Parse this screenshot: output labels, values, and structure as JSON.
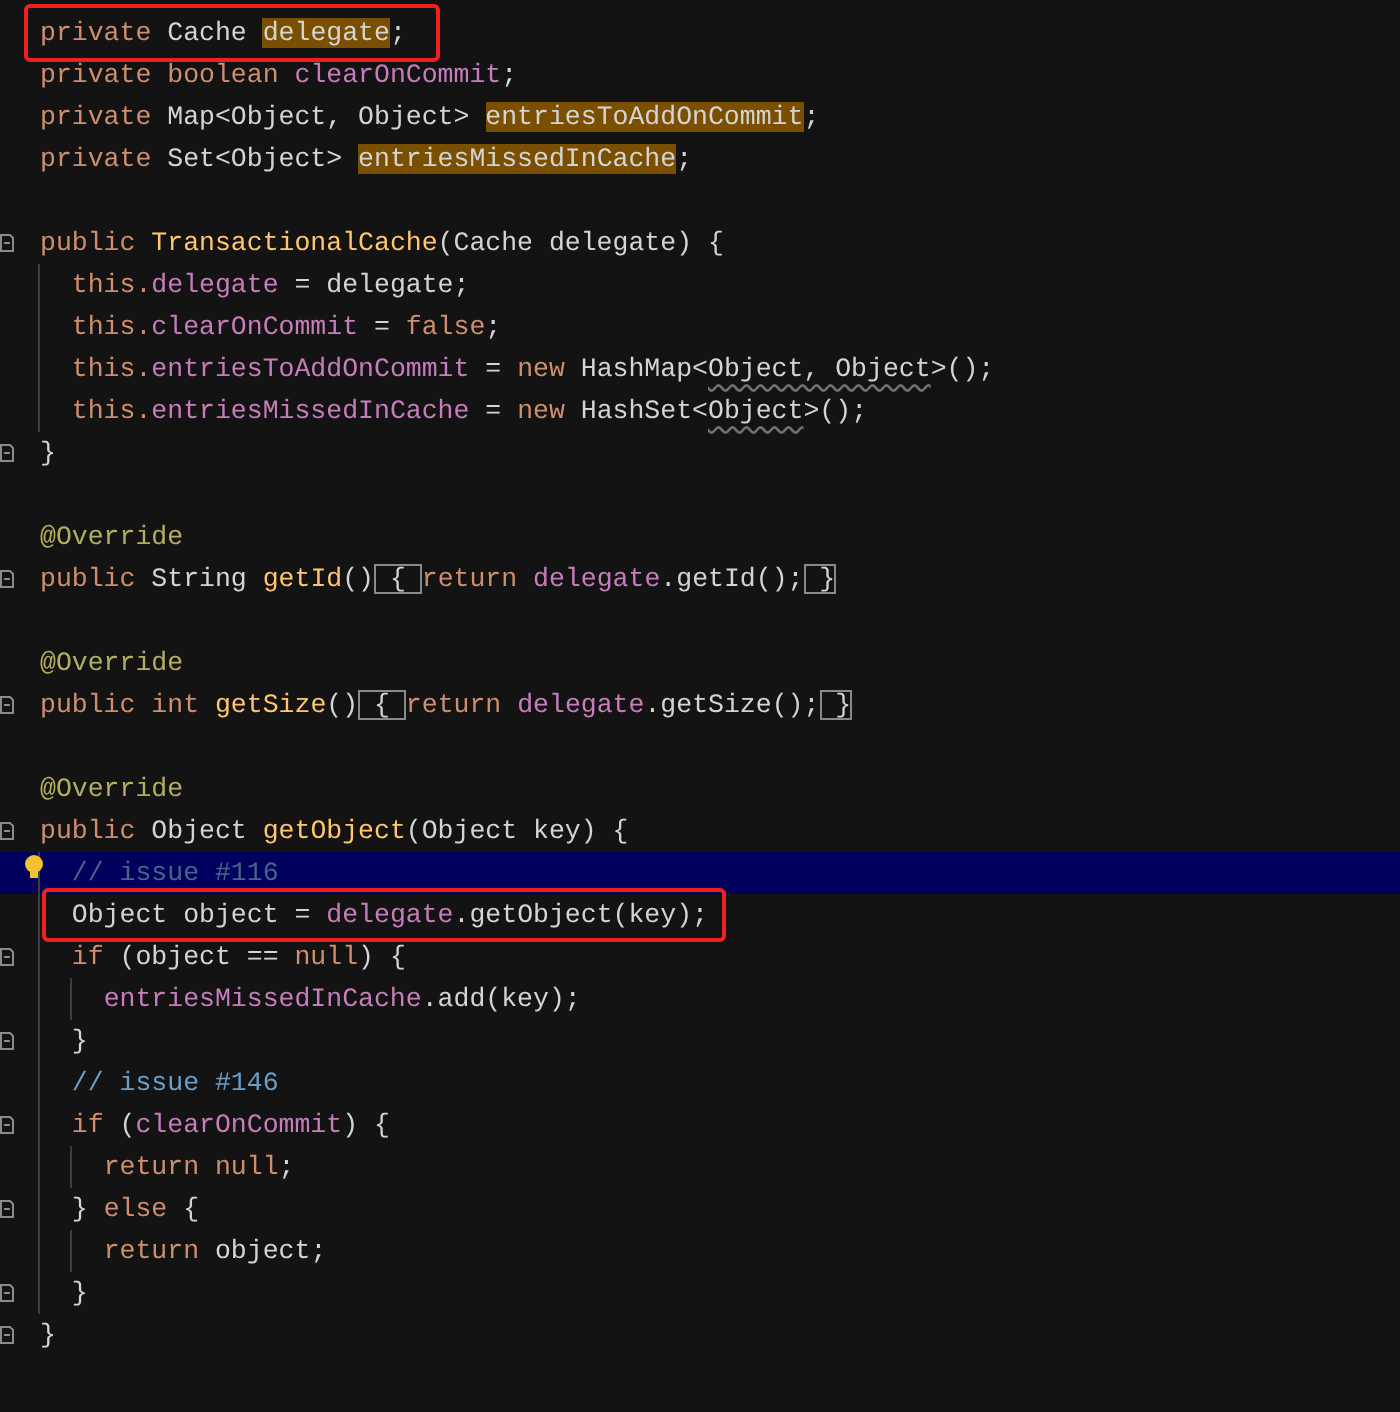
{
  "editor": {
    "lines": [
      {
        "fold": false,
        "caret": false,
        "bulb": false,
        "framed": true,
        "tokens": [
          {
            "kind": "keyword",
            "text": "private "
          },
          {
            "kind": "plain",
            "text": "Cache "
          },
          {
            "kind": "plain",
            "text": "delegate",
            "highlight": true
          },
          {
            "kind": "plain",
            "text": ";"
          }
        ]
      },
      {
        "fold": false,
        "caret": false,
        "bulb": false,
        "framed": false,
        "tokens": [
          {
            "kind": "keyword",
            "text": "private "
          },
          {
            "kind": "keyword",
            "text": "boolean "
          },
          {
            "kind": "field",
            "text": "clearOnCommit"
          },
          {
            "kind": "plain",
            "text": ";"
          }
        ]
      },
      {
        "fold": false,
        "caret": false,
        "bulb": false,
        "framed": false,
        "tokens": [
          {
            "kind": "keyword",
            "text": "private "
          },
          {
            "kind": "plain",
            "text": "Map<Object, Object> "
          },
          {
            "kind": "plain",
            "text": "entriesToAddOnCommit",
            "highlight": true
          },
          {
            "kind": "plain",
            "text": ";"
          }
        ]
      },
      {
        "fold": false,
        "caret": false,
        "bulb": false,
        "framed": false,
        "tokens": [
          {
            "kind": "keyword",
            "text": "private "
          },
          {
            "kind": "plain",
            "text": "Set<Object> "
          },
          {
            "kind": "plain",
            "text": "entriesMissedInCache",
            "highlight": true
          },
          {
            "kind": "plain",
            "text": ";"
          }
        ]
      },
      {
        "fold": false,
        "caret": false,
        "bulb": false,
        "framed": false
      },
      {
        "fold": true,
        "caret": false,
        "bulb": false,
        "framed": false,
        "tokens": [
          {
            "kind": "keyword",
            "text": "public "
          },
          {
            "kind": "method",
            "text": "TransactionalCache"
          },
          {
            "kind": "plain",
            "text": "(Cache delegate) {"
          }
        ]
      },
      {
        "fold": false,
        "caret": false,
        "bulb": false,
        "framed": false,
        "tokens": [
          {
            "kind": "keyword",
            "text": "  this."
          },
          {
            "kind": "field",
            "text": "delegate"
          },
          {
            "kind": "plain",
            "text": " = delegate;"
          }
        ]
      },
      {
        "fold": false,
        "caret": false,
        "bulb": false,
        "framed": false,
        "tokens": [
          {
            "kind": "keyword",
            "text": "  this."
          },
          {
            "kind": "field",
            "text": "clearOnCommit"
          },
          {
            "kind": "plain",
            "text": " = "
          },
          {
            "kind": "keyword",
            "text": "false"
          },
          {
            "kind": "plain",
            "text": ";"
          }
        ]
      },
      {
        "fold": false,
        "caret": false,
        "bulb": false,
        "framed": false,
        "tokens": [
          {
            "kind": "keyword",
            "text": "  this."
          },
          {
            "kind": "field",
            "text": "entriesToAddOnCommit"
          },
          {
            "kind": "plain",
            "text": " = "
          },
          {
            "kind": "keyword",
            "text": "new "
          },
          {
            "kind": "plain",
            "text": "HashMap<"
          },
          {
            "kind": "plain",
            "text": "Object, Object",
            "squiggle": true
          },
          {
            "kind": "plain",
            "text": ">();"
          }
        ]
      },
      {
        "fold": false,
        "caret": false,
        "bulb": false,
        "framed": false,
        "tokens": [
          {
            "kind": "keyword",
            "text": "  this."
          },
          {
            "kind": "field",
            "text": "entriesMissedInCache"
          },
          {
            "kind": "plain",
            "text": " = "
          },
          {
            "kind": "keyword",
            "text": "new "
          },
          {
            "kind": "plain",
            "text": "HashSet<"
          },
          {
            "kind": "plain",
            "text": "Object",
            "squiggle": true
          },
          {
            "kind": "plain",
            "text": ">();"
          }
        ]
      },
      {
        "fold": true,
        "caret": false,
        "bulb": false,
        "framed": false,
        "tokens": [
          {
            "kind": "plain",
            "text": "}"
          }
        ]
      },
      {
        "fold": false,
        "caret": false,
        "bulb": false,
        "framed": false
      },
      {
        "fold": false,
        "caret": false,
        "bulb": false,
        "framed": false,
        "tokens": [
          {
            "kind": "annotation",
            "text": "@Override"
          }
        ]
      },
      {
        "fold": true,
        "caret": false,
        "bulb": false,
        "framed": false,
        "tokens": [
          {
            "kind": "keyword",
            "text": "public "
          },
          {
            "kind": "plain",
            "text": "String "
          },
          {
            "kind": "method",
            "text": "getId"
          },
          {
            "kind": "plain",
            "text": "()"
          },
          {
            "kind": "plain",
            "text": " { ",
            "boxed": true
          },
          {
            "kind": "keyword",
            "text": "return "
          },
          {
            "kind": "field",
            "text": "delegate"
          },
          {
            "kind": "plain",
            "text": ".getId();"
          },
          {
            "kind": "plain",
            "text": " }",
            "boxed": true
          }
        ]
      },
      {
        "fold": false,
        "caret": false,
        "bulb": false,
        "framed": false
      },
      {
        "fold": false,
        "caret": false,
        "bulb": false,
        "framed": false,
        "tokens": [
          {
            "kind": "annotation",
            "text": "@Override"
          }
        ]
      },
      {
        "fold": true,
        "caret": false,
        "bulb": false,
        "framed": false,
        "tokens": [
          {
            "kind": "keyword",
            "text": "public "
          },
          {
            "kind": "keyword",
            "text": "int "
          },
          {
            "kind": "method",
            "text": "getSize"
          },
          {
            "kind": "plain",
            "text": "()"
          },
          {
            "kind": "plain",
            "text": " { ",
            "boxed": true
          },
          {
            "kind": "keyword",
            "text": "return "
          },
          {
            "kind": "field",
            "text": "delegate"
          },
          {
            "kind": "plain",
            "text": ".getSize();"
          },
          {
            "kind": "plain",
            "text": " }",
            "boxed": true
          }
        ]
      },
      {
        "fold": false,
        "caret": false,
        "bulb": false,
        "framed": false
      },
      {
        "fold": false,
        "caret": false,
        "bulb": false,
        "framed": false,
        "tokens": [
          {
            "kind": "annotation",
            "text": "@Override"
          }
        ]
      },
      {
        "fold": true,
        "caret": false,
        "bulb": false,
        "framed": false,
        "tokens": [
          {
            "kind": "keyword",
            "text": "public "
          },
          {
            "kind": "plain",
            "text": "Object "
          },
          {
            "kind": "method",
            "text": "getObject"
          },
          {
            "kind": "plain",
            "text": "(Object key) {"
          }
        ]
      },
      {
        "fold": false,
        "caret": true,
        "bulb": true,
        "framed": false,
        "tokens": [
          {
            "kind": "comment",
            "text": "  // issue #116"
          }
        ]
      },
      {
        "fold": false,
        "caret": false,
        "bulb": false,
        "framed": true,
        "tokens": [
          {
            "kind": "plain",
            "text": "  Object object = "
          },
          {
            "kind": "field",
            "text": "delegate"
          },
          {
            "kind": "plain",
            "text": ".getObject(key);"
          }
        ]
      },
      {
        "fold": true,
        "caret": false,
        "bulb": false,
        "framed": false,
        "tokens": [
          {
            "kind": "keyword",
            "text": "  if "
          },
          {
            "kind": "plain",
            "text": "(object == "
          },
          {
            "kind": "keyword",
            "text": "null"
          },
          {
            "kind": "plain",
            "text": ") {"
          }
        ]
      },
      {
        "fold": false,
        "caret": false,
        "bulb": false,
        "framed": false,
        "tokens": [
          {
            "kind": "field",
            "text": "    entriesMissedInCache"
          },
          {
            "kind": "plain",
            "text": ".add(key);"
          }
        ]
      },
      {
        "fold": true,
        "caret": false,
        "bulb": false,
        "framed": false,
        "tokens": [
          {
            "kind": "plain",
            "text": "  }"
          }
        ]
      },
      {
        "fold": false,
        "caret": false,
        "bulb": false,
        "framed": false,
        "tokens": [
          {
            "kind": "comment",
            "text": "  // issue #146"
          }
        ]
      },
      {
        "fold": true,
        "caret": false,
        "bulb": false,
        "framed": false,
        "tokens": [
          {
            "kind": "keyword",
            "text": "  if "
          },
          {
            "kind": "plain",
            "text": "("
          },
          {
            "kind": "field",
            "text": "clearOnCommit"
          },
          {
            "kind": "plain",
            "text": ") {"
          }
        ]
      },
      {
        "fold": false,
        "caret": false,
        "bulb": false,
        "framed": false,
        "tokens": [
          {
            "kind": "keyword",
            "text": "    return "
          },
          {
            "kind": "keyword",
            "text": "null"
          },
          {
            "kind": "plain",
            "text": ";"
          }
        ]
      },
      {
        "fold": true,
        "caret": false,
        "bulb": false,
        "framed": false,
        "tokens": [
          {
            "kind": "plain",
            "text": "  } "
          },
          {
            "kind": "keyword",
            "text": "else "
          },
          {
            "kind": "plain",
            "text": "{"
          }
        ]
      },
      {
        "fold": false,
        "caret": false,
        "bulb": false,
        "framed": false,
        "tokens": [
          {
            "kind": "keyword",
            "text": "    return "
          },
          {
            "kind": "plain",
            "text": "object;"
          }
        ]
      },
      {
        "fold": true,
        "caret": false,
        "bulb": false,
        "framed": false,
        "tokens": [
          {
            "kind": "plain",
            "text": "  }"
          }
        ]
      },
      {
        "fold": true,
        "caret": false,
        "bulb": false,
        "framed": false,
        "tokens": [
          {
            "kind": "plain",
            "text": "}"
          }
        ]
      }
    ]
  }
}
